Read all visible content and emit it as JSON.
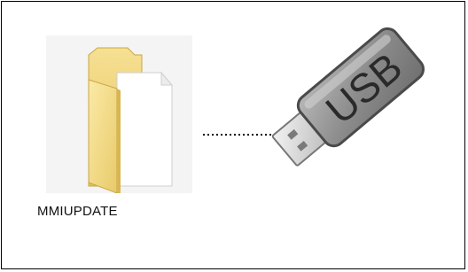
{
  "folder": {
    "name": "MMIUPDATE",
    "icon": "folder-with-document-icon"
  },
  "arrow": {
    "style": "dotted",
    "icon": "right-arrow-icon"
  },
  "usb": {
    "label": "USB",
    "icon": "usb-flash-drive-icon"
  },
  "colors": {
    "folder_front": "#f2d77a",
    "folder_back": "#e6c65a",
    "document": "#ffffff",
    "usb_body": "#9a9a9a",
    "usb_connector": "#d6d6d6",
    "border": "#000000"
  }
}
